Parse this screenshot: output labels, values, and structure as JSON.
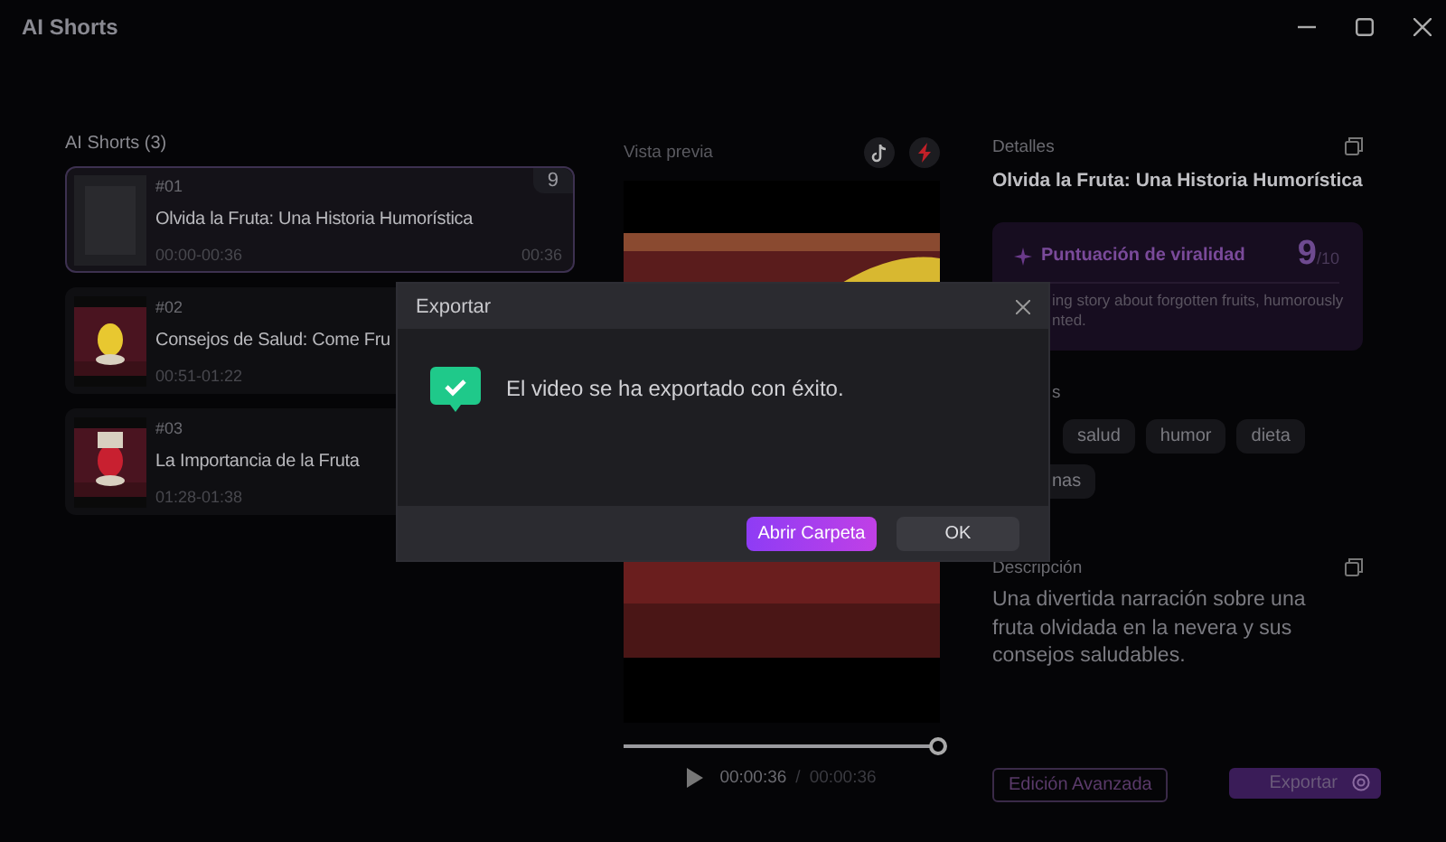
{
  "window": {
    "title": "AI Shorts"
  },
  "shorts_list": {
    "heading": "AI Shorts (3)",
    "items": [
      {
        "number": "#01",
        "title": "Olvida la Fruta: Una Historia Humorística",
        "range": "00:00-00:36",
        "duration": "00:36",
        "score": "9",
        "selected": true,
        "thumbnail": {
          "kind": "blank"
        }
      },
      {
        "number": "#02",
        "title": "Consejos de Salud: Come Fru",
        "range": "00:51-01:22",
        "selected": false
      },
      {
        "number": "#03",
        "title": "La Importancia de la Fruta",
        "range": "01:28-01:38",
        "selected": false
      }
    ]
  },
  "preview": {
    "label": "Vista previa",
    "progress": {
      "level": 1
    },
    "current_time": "00:00:36",
    "time_separator": "/",
    "total_time": "00:00:36"
  },
  "details": {
    "label": "Detalles",
    "title": "Olvida la Fruta: Una Historia Humorística",
    "virality": {
      "label": "Puntuación de viralidad",
      "score": "9",
      "out_of": "/10",
      "lines": [
        "ing story about forgotten fruits, humorously",
        "nted."
      ]
    },
    "tags_label": "s",
    "tag_rows": [
      [
        "salud",
        "humor",
        "dieta"
      ],
      [
        "nas"
      ]
    ],
    "description": {
      "label": "Descripción",
      "text": "Una divertida narración sobre una fruta olvidada en la nevera y sus consejos saludables."
    },
    "actions": {
      "advanced": "Edición Avanzada",
      "export": "Exportar"
    }
  },
  "dialog": {
    "title": "Exportar",
    "message": "El video se ha exportado con éxito.",
    "buttons": [
      {
        "label": "Abrir Carpeta",
        "kind": "primary"
      },
      {
        "label": "OK",
        "kind": "secondary"
      }
    ]
  }
}
